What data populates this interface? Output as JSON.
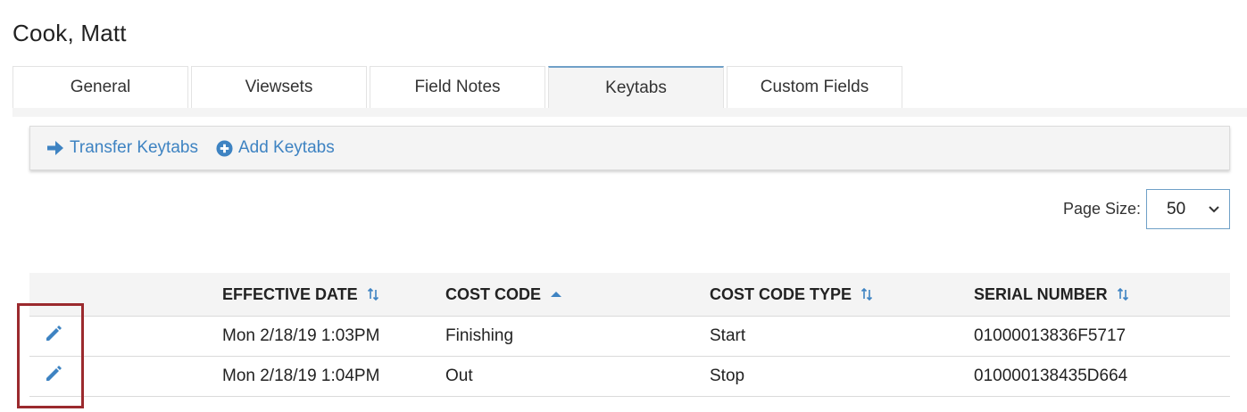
{
  "page": {
    "title": "Cook, Matt"
  },
  "tabs": [
    {
      "label": "General"
    },
    {
      "label": "Viewsets"
    },
    {
      "label": "Field Notes"
    },
    {
      "label": "Keytabs"
    },
    {
      "label": "Custom Fields"
    }
  ],
  "active_tab": "Keytabs",
  "toolbar": {
    "transfer_label": "Transfer Keytabs",
    "add_label": "Add Keytabs"
  },
  "page_size": {
    "label": "Page Size:",
    "value": "50"
  },
  "table": {
    "columns": [
      {
        "label": "EFFECTIVE DATE",
        "sort": "none"
      },
      {
        "label": "COST CODE",
        "sort": "asc"
      },
      {
        "label": "COST CODE TYPE",
        "sort": "none"
      },
      {
        "label": "SERIAL NUMBER",
        "sort": "none"
      }
    ],
    "rows": [
      {
        "effective_date": "Mon 2/18/19 1:03PM",
        "cost_code": "Finishing",
        "cost_code_type": "Start",
        "serial_number": "01000013836F5717"
      },
      {
        "effective_date": "Mon 2/18/19 1:04PM",
        "cost_code": "Out",
        "cost_code_type": "Stop",
        "serial_number": "010000138435D664"
      }
    ]
  },
  "colors": {
    "accent": "#3e83c2",
    "highlight": "#9b2a2e",
    "header_bg": "#f4f4f4"
  },
  "icons": {
    "transfer": "arrow-right-icon",
    "add": "plus-circle-icon",
    "edit": "pencil-icon",
    "sort": "sort-icon",
    "sort_asc": "sort-asc-icon",
    "select": "chevron-down-icon"
  }
}
